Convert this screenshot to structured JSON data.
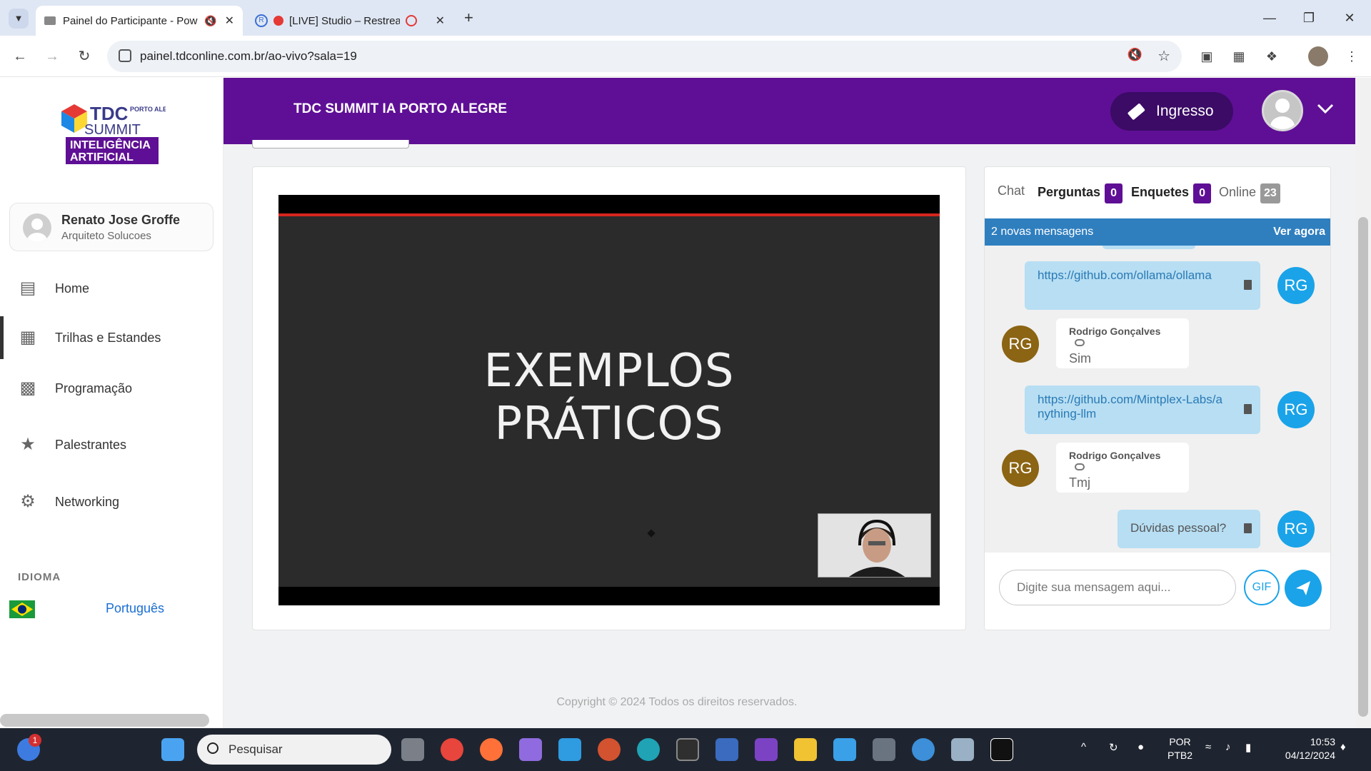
{
  "browser": {
    "tabs": [
      {
        "title": "Painel do Participante - Pow",
        "active": true
      },
      {
        "title": "[LIVE] Studio – Restream",
        "active": false
      }
    ],
    "url": "painel.tdconline.com.br/ao-vivo?sala=19"
  },
  "sidebar": {
    "logo_text": [
      "TDC",
      "PORTO ALEGRE",
      "SUMMIT",
      "INTELIGÊNCIA",
      "ARTIFICIAL"
    ],
    "user": {
      "name": "Renato Jose Groffe",
      "role": "Arquiteto Solucoes"
    },
    "items": [
      {
        "label": "Home",
        "icon": "home-icon"
      },
      {
        "label": "Trilhas e Estandes",
        "icon": "grid-icon"
      },
      {
        "label": "Programação",
        "icon": "calendar-icon"
      },
      {
        "label": "Palestrantes",
        "icon": "star-icon"
      },
      {
        "label": "Networking",
        "icon": "networking-icon"
      }
    ],
    "idioma_label": "IDIOMA",
    "language": "Português"
  },
  "header": {
    "title": "TDC SUMMIT IA PORTO ALEGRE",
    "ingresso_label": "Ingresso"
  },
  "video": {
    "slide_line1": "EXEMPLOS",
    "slide_line2": "PRÁTICOS"
  },
  "chat": {
    "tabs": [
      {
        "label": "Chat",
        "count": null
      },
      {
        "label": "Perguntas",
        "count": "0"
      },
      {
        "label": "Enquetes",
        "count": "0"
      },
      {
        "label": "Online",
        "count": "23"
      }
    ],
    "new_messages": "2 novas mensagens",
    "see_now": "Ver agora",
    "messages": [
      {
        "side": "right",
        "initials": "RG",
        "text": "https://github.com/ollama/ollama",
        "link": true
      },
      {
        "side": "left",
        "initials": "RG",
        "author": "Rodrigo Gonçalves",
        "text": "Sim"
      },
      {
        "side": "right",
        "initials": "RG",
        "text": "https://github.com/Mintplex-Labs/anything-llm",
        "link": true
      },
      {
        "side": "left",
        "initials": "RG",
        "author": "Rodrigo Gonçalves",
        "text": "Tmj"
      },
      {
        "side": "right",
        "initials": "RG",
        "text": "Dúvidas pessoal?",
        "link": false
      }
    ],
    "input_placeholder": "Digite sua mensagem aqui...",
    "gif_label": "GIF"
  },
  "footer": {
    "copyright": "Copyright © 2024 Todos os direitos reservados."
  },
  "taskbar": {
    "search_label": "Pesquisar",
    "notification_count": "1",
    "lang_line1": "POR",
    "lang_line2": "PTB2",
    "time": "10:53",
    "date": "04/12/2024"
  },
  "colors": {
    "header_purple": "#5f0f95",
    "chat_blue": "#1aa3e8",
    "new_msg_bar": "#2f7fbf",
    "left_avatar": "#8b6414"
  }
}
